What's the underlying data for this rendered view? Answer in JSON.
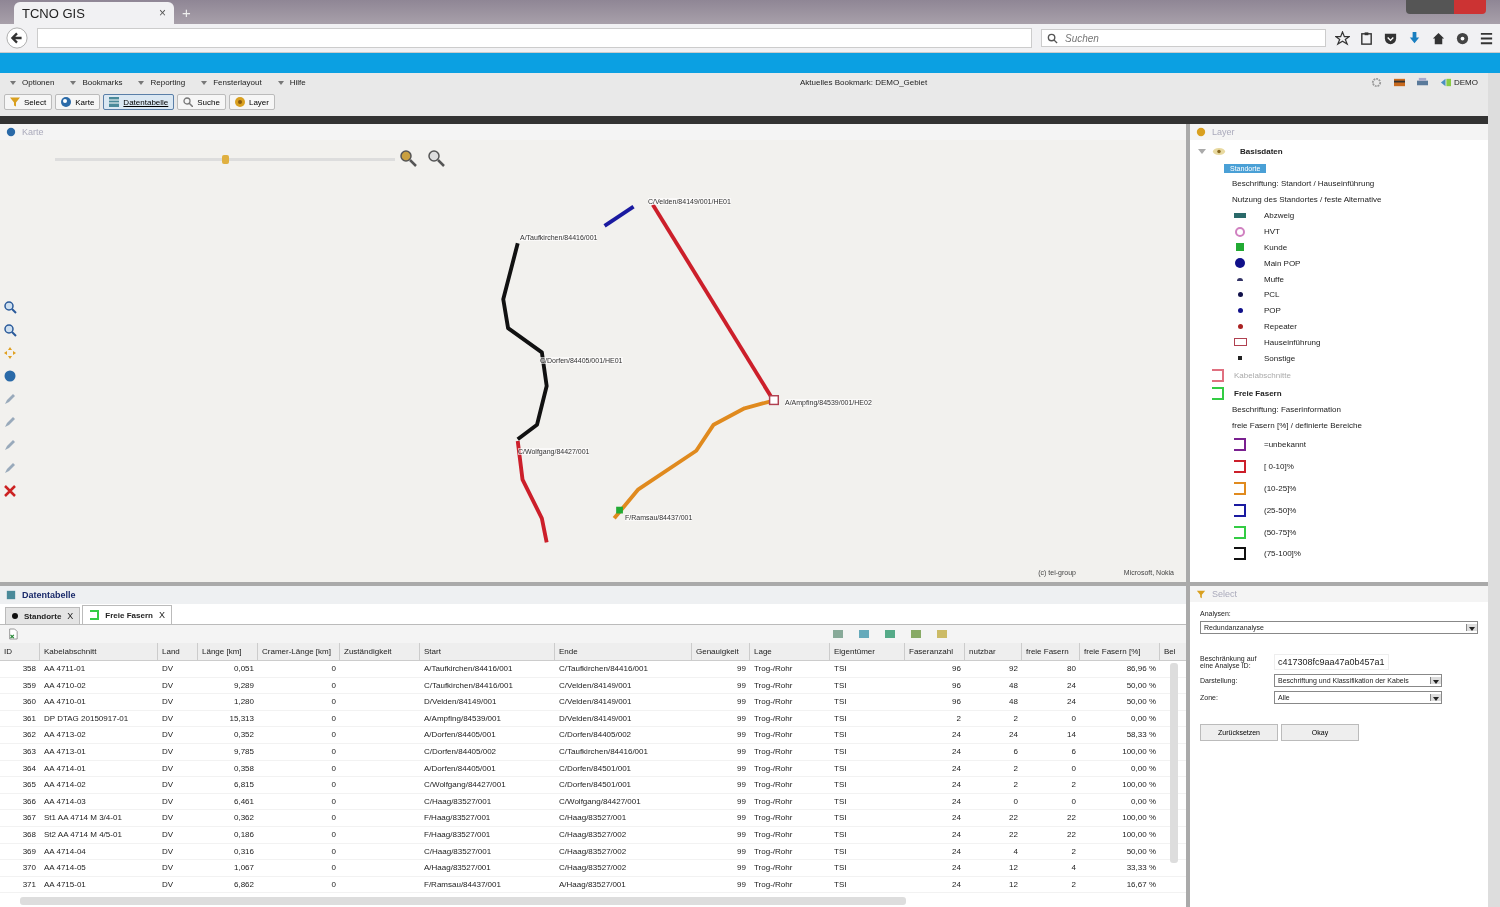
{
  "browser": {
    "tab_title": "TCNO GIS",
    "tab_close": "×",
    "new_tab": "+",
    "search_placeholder": "Suchen"
  },
  "menu": [
    {
      "label": "Optionen"
    },
    {
      "label": "Bookmarks"
    },
    {
      "label": "Reporting"
    },
    {
      "label": "Fensterlayout"
    },
    {
      "label": "Hilfe"
    }
  ],
  "bookmark": "Aktuelles Bookmark: DEMO_Gebiet",
  "user": "DEMO",
  "toolbar": [
    {
      "label": "Select",
      "selected": false
    },
    {
      "label": "Karte",
      "selected": false
    },
    {
      "label": "Datentabelle",
      "selected": true
    },
    {
      "label": "Suche",
      "selected": false
    },
    {
      "label": "Layer",
      "selected": false
    }
  ],
  "map": {
    "title": "Karte",
    "zoom_slider": {
      "level": 0.5
    },
    "routes": [
      {
        "color": "#1a1aa0"
      },
      {
        "color": "#cc1f2a"
      },
      {
        "color": "#111111"
      },
      {
        "color": "#cc1f2a"
      },
      {
        "color": "#e08a1e"
      }
    ],
    "nodes": [
      {
        "label": "C/Velden/84149/001/HE01"
      },
      {
        "label": "A/Taufkirchen/84416/001"
      },
      {
        "label": "C/Dorfen/84405/001/HE01"
      },
      {
        "label": "C/Wolfgang/84427/001"
      },
      {
        "label": "A/Ampfing/84539/001/HE02"
      },
      {
        "label": "F/Ramsau/84437/001"
      }
    ],
    "attribution": [
      "(c) tei-group",
      "Microsoft, Nokia"
    ]
  },
  "layers": {
    "title": "Layer",
    "group": "Basisdaten",
    "expanded": true,
    "items": [
      {
        "label": "Standorte",
        "kind": "badge",
        "enabled": true,
        "caption": "Beschriftung: Standort / Hauseinführung",
        "classification": "Nutzung des Standortes / feste Alternative",
        "legend": [
          {
            "label": "Abzweig",
            "kind": "bar",
            "color": "#2a6a6a"
          },
          {
            "label": "HVT",
            "kind": "ring",
            "color": "#d080c0"
          },
          {
            "label": "Kunde",
            "kind": "square",
            "color": "#22aa33"
          },
          {
            "label": "Main POP",
            "kind": "bigdot",
            "color": "#10108a"
          },
          {
            "label": "Muffe",
            "kind": "half",
            "color": "#333366"
          },
          {
            "label": "PCL",
            "kind": "dot",
            "color": "#10104a"
          },
          {
            "label": "POP",
            "kind": "dot",
            "color": "#10108a"
          },
          {
            "label": "Repeater",
            "kind": "dot",
            "color": "#aa2222"
          },
          {
            "label": "Hauseinführung",
            "kind": "rect",
            "color": "#b04050"
          },
          {
            "label": "Sonstige",
            "kind": "tiny",
            "color": "#222222"
          }
        ]
      },
      {
        "label": "Kabelabschnitte",
        "kind": "bracket",
        "color": "#e07080",
        "enabled": false
      },
      {
        "label": "Freie Fasern",
        "kind": "bracket",
        "color": "#33cc44",
        "enabled": true,
        "caption": "Beschriftung: Faserinformation",
        "classification": "freie Fasern [%] / definierte Bereiche",
        "legend": [
          {
            "label": "=unbekannt",
            "kind": "bracket",
            "color": "#7a2090"
          },
          {
            "label": "[ 0-10]%",
            "kind": "bracket",
            "color": "#cc1f2a"
          },
          {
            "label": "(10-25]%",
            "kind": "bracket",
            "color": "#e08a1e"
          },
          {
            "label": "(25-50]%",
            "kind": "bracket",
            "color": "#1a1aa0"
          },
          {
            "label": "(50-75]%",
            "kind": "bracket",
            "color": "#33cc44"
          },
          {
            "label": "(75-100]%",
            "kind": "bracket",
            "color": "#111111"
          }
        ]
      }
    ]
  },
  "datatable": {
    "title": "Datentabelle",
    "tabs": [
      {
        "label": "Standorte",
        "close": "X",
        "selected": false
      },
      {
        "label": "Freie Fasern",
        "close": "X",
        "selected": true
      }
    ],
    "columns": [
      "ID",
      "Kabelabschnitt",
      "Land",
      "Länge [km]",
      "Cramer-Länge [km]",
      "Zuständigkeit",
      "Start",
      "Ende",
      "Genauigkeit",
      "Lage",
      "Eigentümer",
      "Faseranzahl",
      "nutzbar",
      "freie Fasern",
      "freie Fasern [%]",
      "Bel"
    ],
    "rows": [
      [
        "358",
        "AA 4711-01",
        "DV",
        "0,051",
        "0",
        "",
        "A/Taufkirchen/84416/001",
        "C/Taufkirchen/84416/001",
        "99",
        "Trog-/Rohr",
        "TSI",
        "96",
        "92",
        "80",
        "86,96 %"
      ],
      [
        "359",
        "AA 4710-02",
        "DV",
        "9,289",
        "0",
        "",
        "C/Taufkirchen/84416/001",
        "C/Velden/84149/001",
        "99",
        "Trog-/Rohr",
        "TSI",
        "96",
        "48",
        "24",
        "50,00 %"
      ],
      [
        "360",
        "AA 4710-01",
        "DV",
        "1,280",
        "0",
        "",
        "D/Velden/84149/001",
        "C/Velden/84149/001",
        "99",
        "Trog-/Rohr",
        "TSI",
        "96",
        "48",
        "24",
        "50,00 %"
      ],
      [
        "361",
        "DP DTAG 20150917-01",
        "DV",
        "15,313",
        "0",
        "",
        "A/Ampfing/84539/001",
        "D/Velden/84149/001",
        "99",
        "Trog-/Rohr",
        "TSI",
        "2",
        "2",
        "0",
        "0,00 %"
      ],
      [
        "362",
        "AA 4713-02",
        "DV",
        "0,352",
        "0",
        "",
        "A/Dorfen/84405/001",
        "C/Dorfen/84405/002",
        "99",
        "Trog-/Rohr",
        "TSI",
        "24",
        "24",
        "14",
        "58,33 %"
      ],
      [
        "363",
        "AA 4713-01",
        "DV",
        "9,785",
        "0",
        "",
        "C/Dorfen/84405/002",
        "C/Taufkirchen/84416/001",
        "99",
        "Trog-/Rohr",
        "TSI",
        "24",
        "6",
        "6",
        "100,00 %"
      ],
      [
        "364",
        "AA 4714-01",
        "DV",
        "0,358",
        "0",
        "",
        "A/Dorfen/84405/001",
        "C/Dorfen/84501/001",
        "99",
        "Trog-/Rohr",
        "TSI",
        "24",
        "2",
        "0",
        "0,00 %"
      ],
      [
        "365",
        "AA 4714-02",
        "DV",
        "6,815",
        "0",
        "",
        "C/Wolfgang/84427/001",
        "C/Dorfen/84501/001",
        "99",
        "Trog-/Rohr",
        "TSI",
        "24",
        "2",
        "2",
        "100,00 %"
      ],
      [
        "366",
        "AA 4714-03",
        "DV",
        "6,461",
        "0",
        "",
        "C/Haag/83527/001",
        "C/Wolfgang/84427/001",
        "99",
        "Trog-/Rohr",
        "TSI",
        "24",
        "0",
        "0",
        "0,00 %"
      ],
      [
        "367",
        "St1 AA 4714 M 3/4-01",
        "DV",
        "0,362",
        "0",
        "",
        "F/Haag/83527/001",
        "C/Haag/83527/001",
        "99",
        "Trog-/Rohr",
        "TSI",
        "24",
        "22",
        "22",
        "100,00 %"
      ],
      [
        "368",
        "St2 AA 4714 M 4/5-01",
        "DV",
        "0,186",
        "0",
        "",
        "F/Haag/83527/001",
        "C/Haag/83527/002",
        "99",
        "Trog-/Rohr",
        "TSI",
        "24",
        "22",
        "22",
        "100,00 %"
      ],
      [
        "369",
        "AA 4714-04",
        "DV",
        "0,316",
        "0",
        "",
        "C/Haag/83527/001",
        "C/Haag/83527/002",
        "99",
        "Trog-/Rohr",
        "TSI",
        "24",
        "4",
        "2",
        "50,00 %"
      ],
      [
        "370",
        "AA 4714-05",
        "DV",
        "1,067",
        "0",
        "",
        "A/Haag/83527/001",
        "C/Haag/83527/002",
        "99",
        "Trog-/Rohr",
        "TSI",
        "24",
        "12",
        "4",
        "33,33 %"
      ],
      [
        "371",
        "AA 4715-01",
        "DV",
        "6,862",
        "0",
        "",
        "F/Ramsau/84437/001",
        "A/Haag/83527/001",
        "99",
        "Trog-/Rohr",
        "TSI",
        "24",
        "12",
        "2",
        "16,67 %"
      ]
    ]
  },
  "select": {
    "title": "Select",
    "analysen_label": "Analysen:",
    "analysen_value": "Redundanzanalyse",
    "id_label": "Beschränkung auf eine Analyse ID:",
    "id_value": "c417308fc9aa47a0b457a1",
    "darstellung_label": "Darstellung:",
    "darstellung_value": "Beschriftung und Klassifikation der Kabels",
    "zone_label": "Zone:",
    "zone_value": "Alle",
    "buttons": [
      "Zurücksetzen",
      "Okay"
    ]
  }
}
